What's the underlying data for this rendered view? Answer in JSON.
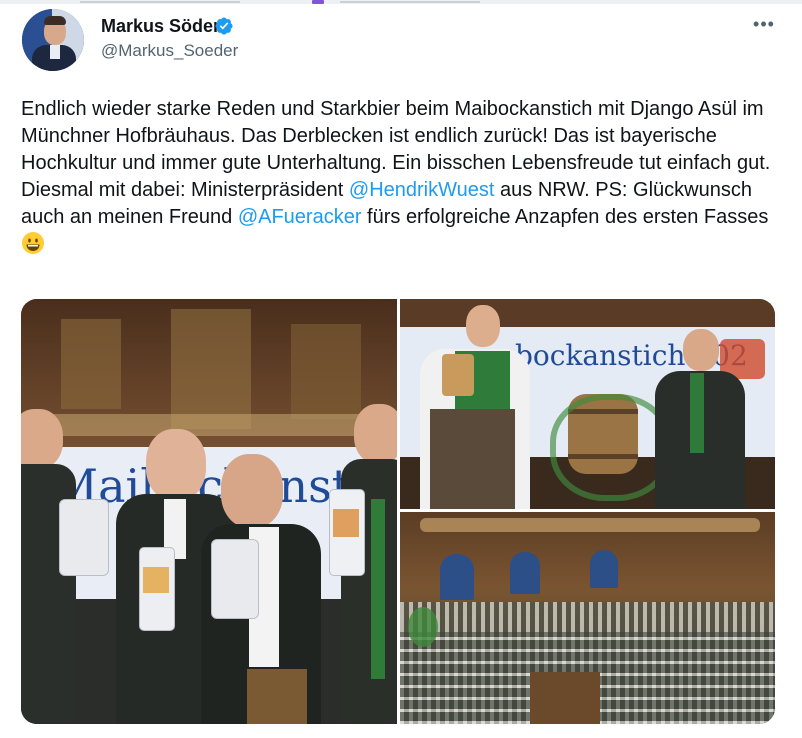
{
  "author": {
    "display_name": "Markus Söder",
    "handle": "@Markus_Soeder",
    "verified": true,
    "avatar_icon": "profile-photo"
  },
  "more_icon": "more-horizontal-icon",
  "tweet": {
    "part1": "Endlich wieder starke Reden und Starkbier beim Maibockanstich mit Django Asül im Münchner Hofbräuhaus. Das Derblecken ist endlich zurück! Das ist bayerische Hochkultur und immer gute Unterhaltung. Ein bisschen Lebensfreude tut einfach gut. Diesmal mit dabei: Ministerpräsident ",
    "mention1": "@HendrikWuest",
    "part2": " aus NRW. PS: Glückwunsch auch an meinen Freund ",
    "mention2": "@AFueracker",
    "part3": " fürs erfolgreiche Anzapfen des ersten Fasses ",
    "emoji": "grinning-face"
  },
  "media": {
    "photo1_banner": "Maibockanstich",
    "photo2_banner": "bockanstich 202"
  },
  "colors": {
    "text": "#0f1419",
    "secondary": "#536471",
    "link": "#1d9bf0",
    "verified": "#1d9bf0"
  }
}
